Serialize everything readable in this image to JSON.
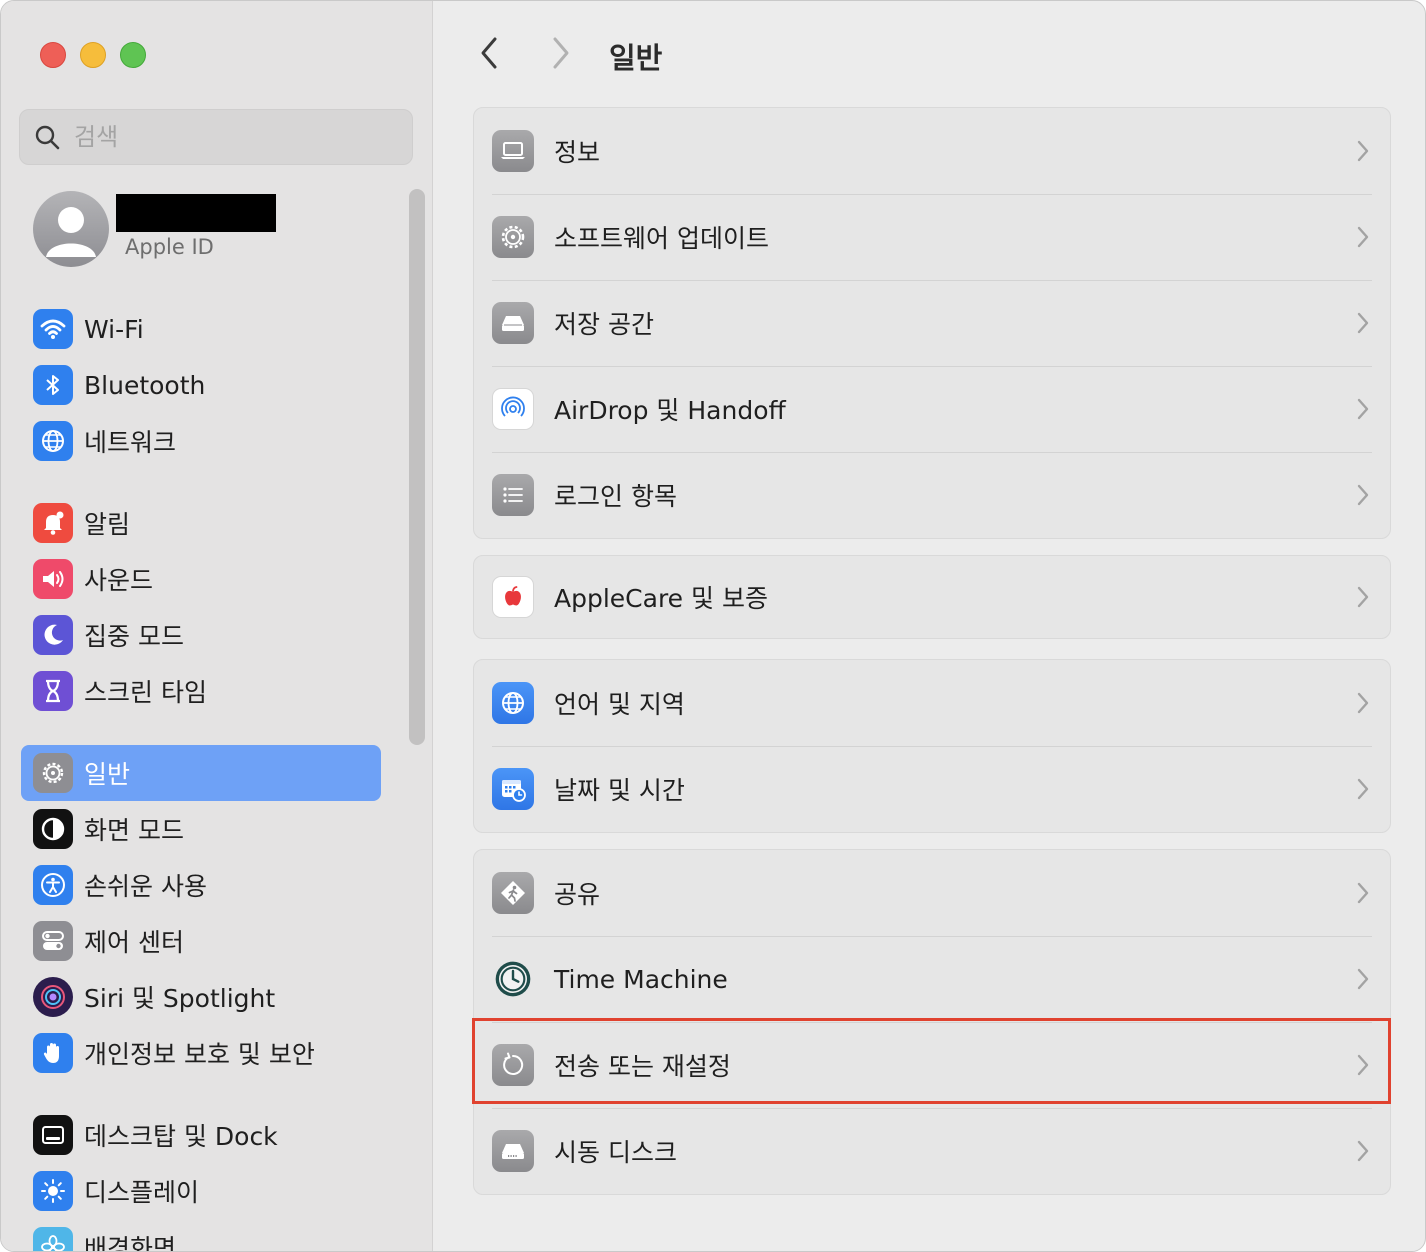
{
  "window": {
    "controls": [
      "close",
      "minimize",
      "zoom"
    ]
  },
  "sidebar": {
    "search_placeholder": "검색",
    "account": {
      "subtitle": "Apple ID"
    },
    "items": [
      {
        "label": "Wi-Fi",
        "icon": "wifi-icon",
        "color": "#2f80ee"
      },
      {
        "label": "Bluetooth",
        "icon": "bluetooth-icon",
        "color": "#2f80ee"
      },
      {
        "label": "네트워크",
        "icon": "globe-icon",
        "color": "#2f80ee"
      },
      {
        "label": "알림",
        "icon": "bell-icon",
        "color": "#ef4b3f"
      },
      {
        "label": "사운드",
        "icon": "speaker-icon",
        "color": "#ef4a6a"
      },
      {
        "label": "집중 모드",
        "icon": "moon-icon",
        "color": "#5c55d6"
      },
      {
        "label": "스크린 타임",
        "icon": "hourglass-icon",
        "color": "#6f4fd4"
      },
      {
        "label": "일반",
        "icon": "gear-icon",
        "color": "#8e8e93",
        "selected": true
      },
      {
        "label": "화면 모드",
        "icon": "appearance-icon",
        "color": "#111111"
      },
      {
        "label": "손쉬운 사용",
        "icon": "accessibility-icon",
        "color": "#2f80ee"
      },
      {
        "label": "제어 센터",
        "icon": "toggles-icon",
        "color": "#8e8e93"
      },
      {
        "label": "Siri 및 Spotlight",
        "icon": "siri-icon",
        "color": "#2b1d4d"
      },
      {
        "label": "개인정보 보호 및 보안",
        "icon": "hand-icon",
        "color": "#2f80ee"
      },
      {
        "label": "데스크탑 및 Dock",
        "icon": "dock-icon",
        "color": "#111111"
      },
      {
        "label": "디스플레이",
        "icon": "sun-icon",
        "color": "#2f80ee"
      },
      {
        "label": "배경화면",
        "icon": "flower-icon",
        "color": "#4fb6e8"
      }
    ]
  },
  "header": {
    "title": "일반",
    "back_icon": "chevron-left-icon",
    "forward_icon": "chevron-right-icon"
  },
  "groups": [
    {
      "rows": [
        {
          "label": "정보",
          "icon": "laptop-icon"
        },
        {
          "label": "소프트웨어 업데이트",
          "icon": "gear-badge-icon"
        },
        {
          "label": "저장 공간",
          "icon": "drive-icon"
        },
        {
          "label": "AirDrop 및 Handoff",
          "icon": "airdrop-icon"
        },
        {
          "label": "로그인 항목",
          "icon": "list-icon"
        }
      ]
    },
    {
      "rows": [
        {
          "label": "AppleCare 및 보증",
          "icon": "apple-icon"
        }
      ]
    },
    {
      "rows": [
        {
          "label": "언어 및 지역",
          "icon": "globe-icon"
        },
        {
          "label": "날짜 및 시간",
          "icon": "calendar-clock-icon"
        }
      ]
    },
    {
      "rows": [
        {
          "label": "공유",
          "icon": "sharing-icon"
        },
        {
          "label": "Time Machine",
          "icon": "time-machine-icon"
        },
        {
          "label": "전송 또는 재설정",
          "icon": "reset-icon",
          "highlighted": true
        },
        {
          "label": "시동 디스크",
          "icon": "startup-disk-icon"
        }
      ]
    }
  ],
  "highlight_color": "#e0422f"
}
